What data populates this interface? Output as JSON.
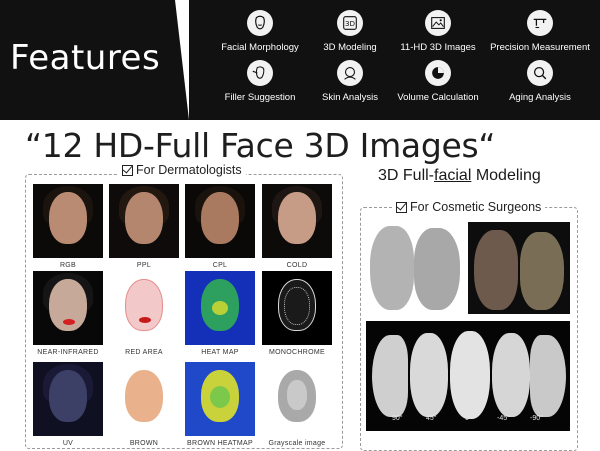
{
  "header": {
    "title": "Features",
    "features": [
      {
        "label": "Facial Morphology",
        "icon": "face-outline-icon"
      },
      {
        "label": "3D Modeling",
        "icon": "3d-cube-icon"
      },
      {
        "label": "11-HD 3D Images",
        "icon": "image-icon"
      },
      {
        "label": "Precision Measurement",
        "icon": "caliper-icon"
      },
      {
        "label": "Filler Suggestion",
        "icon": "syringe-face-icon"
      },
      {
        "label": "Skin Analysis",
        "icon": "face-scan-icon"
      },
      {
        "label": "Volume Calculation",
        "icon": "pie-chart-icon"
      },
      {
        "label": "Aging Analysis",
        "icon": "magnifier-icon"
      }
    ],
    "icon_3d_text": "3D"
  },
  "headline": "“12 HD-Full Face 3D Images“",
  "dermatologists": {
    "legend": "For Dermatologists",
    "images": [
      {
        "caption": "RGB"
      },
      {
        "caption": "PPL"
      },
      {
        "caption": "CPL"
      },
      {
        "caption": "COLD"
      },
      {
        "caption": "NEAR-INFRARED"
      },
      {
        "caption": "RED AREA"
      },
      {
        "caption": "HEAT MAP"
      },
      {
        "caption": "MONOCHROME"
      },
      {
        "caption": "UV"
      },
      {
        "caption": "BROWN"
      },
      {
        "caption": "BROWN HEATMAP"
      },
      {
        "caption": "Grayscale image"
      }
    ]
  },
  "modeling": {
    "title_prefix": "3D Full-",
    "title_underlined": "facial",
    "title_suffix": " Modeling",
    "legend": "For Cosmetic Surgeons",
    "angles": [
      "90°",
      "45°",
      "0°",
      "-45°",
      "-90°"
    ]
  },
  "colors": {
    "header_bg": "#111111",
    "header_text": "#ffffff"
  }
}
